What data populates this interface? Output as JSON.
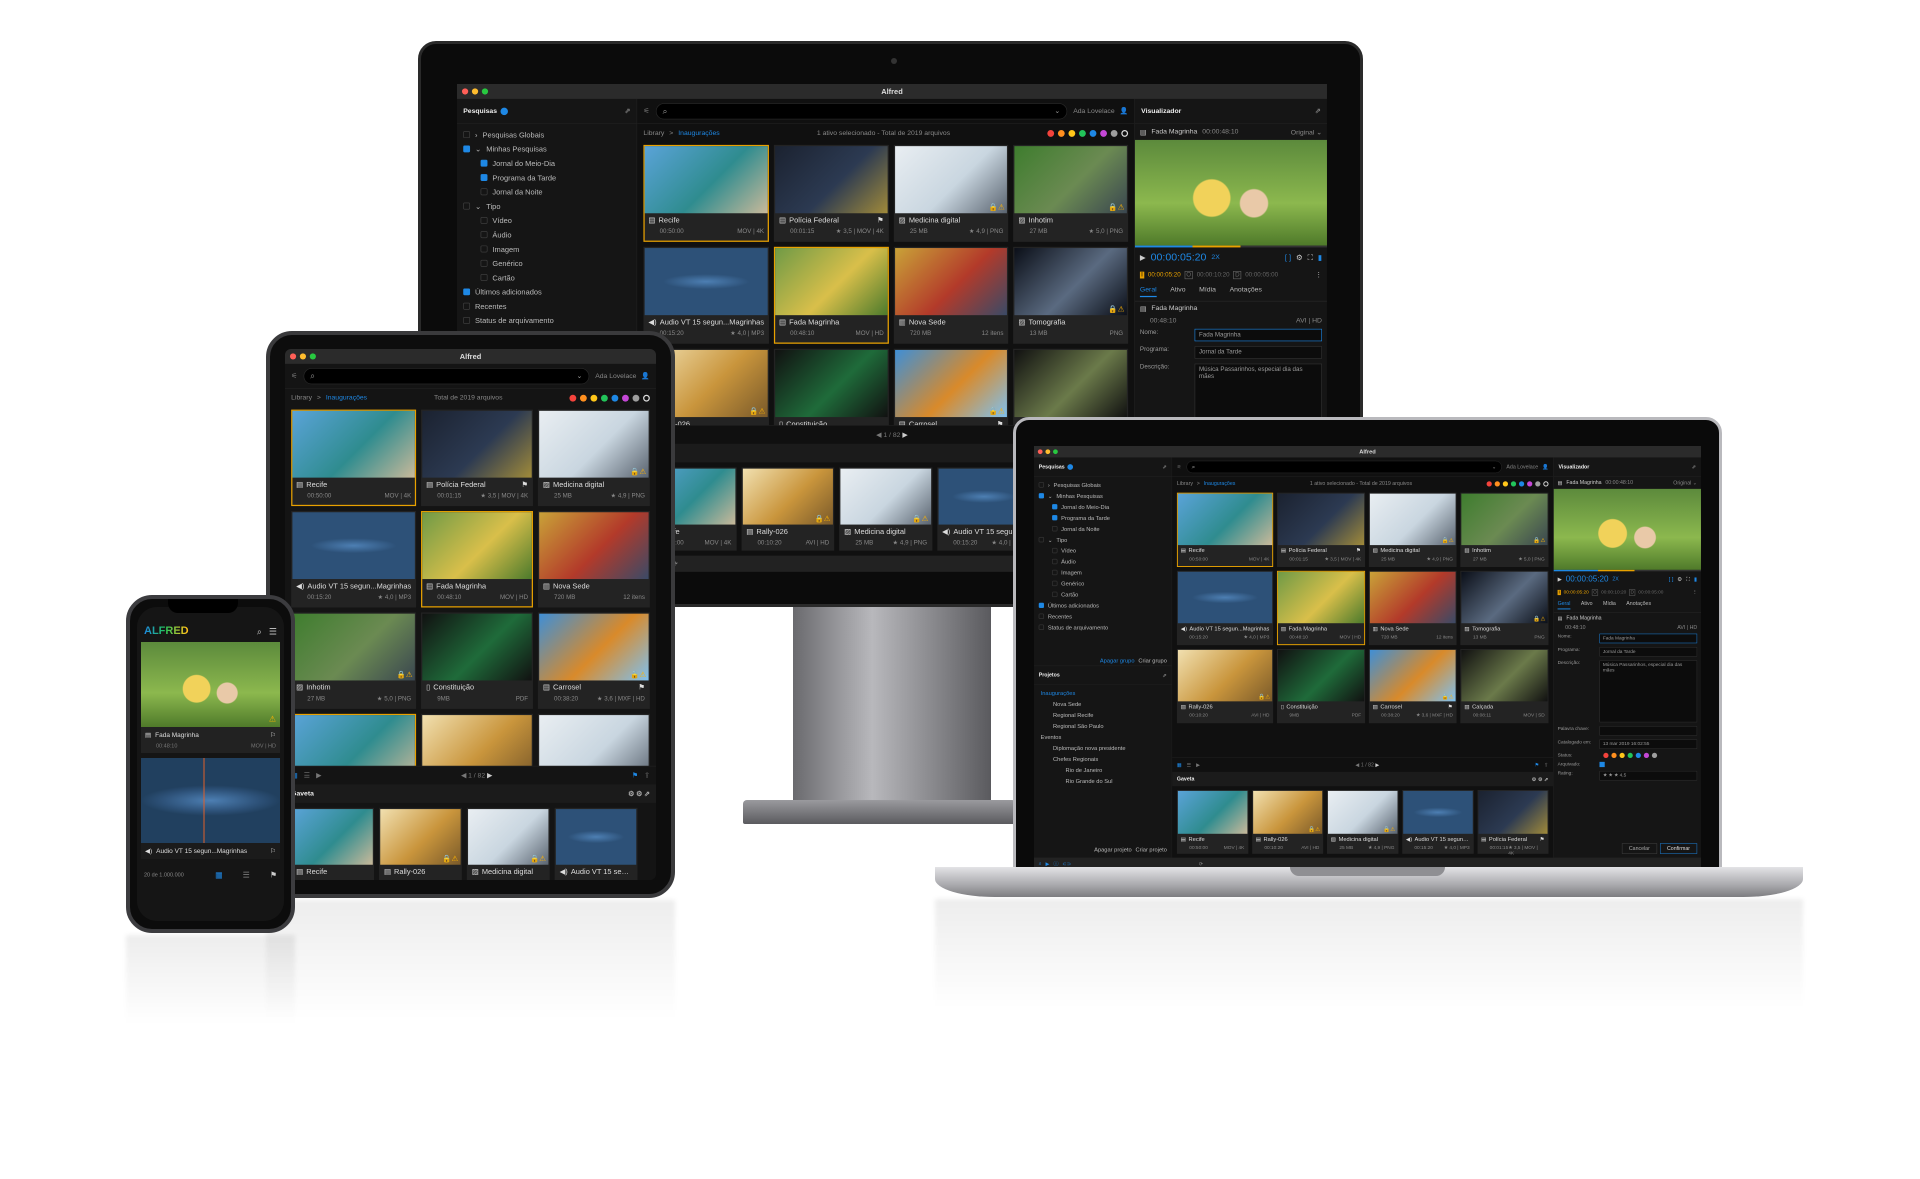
{
  "app": {
    "title": "Alfred",
    "user": "Ada Lovelace",
    "search_placeholder": "",
    "searches_title": "Pesquisas",
    "tree": [
      {
        "label": "Pesquisas Globais",
        "level": 0,
        "arrow": "›",
        "checked": false
      },
      {
        "label": "Minhas Pesquisas",
        "level": 0,
        "arrow": "⌄",
        "checked": true
      },
      {
        "label": "Jornal do Meio-Dia",
        "level": 1,
        "checked": true
      },
      {
        "label": "Programa da Tarde",
        "level": 1,
        "checked": true
      },
      {
        "label": "Jornal da Noite",
        "level": 1,
        "checked": false
      },
      {
        "label": "Tipo",
        "level": 0,
        "arrow": "⌄",
        "checked": false
      },
      {
        "label": "Vídeo",
        "level": 1,
        "checked": false
      },
      {
        "label": "Áudio",
        "level": 1,
        "checked": false
      },
      {
        "label": "Imagem",
        "level": 1,
        "checked": false
      },
      {
        "label": "Genérico",
        "level": 1,
        "checked": false
      },
      {
        "label": "Cartão",
        "level": 1,
        "checked": false
      },
      {
        "label": "Últimos adicionados",
        "level": 0,
        "checked": true
      },
      {
        "label": "Recentes",
        "level": 0,
        "checked": false
      },
      {
        "label": "Status de arquivamento",
        "level": 0,
        "checked": false
      }
    ],
    "group_actions": {
      "delete": "Apagar grupo",
      "create": "Criar grupo"
    },
    "projects_title": "Projetos",
    "projects": [
      {
        "label": "Inaugurações",
        "level": 0,
        "active": true
      },
      {
        "label": "Nova Sede",
        "level": 1
      },
      {
        "label": "Regional Recife",
        "level": 1
      },
      {
        "label": "Regional São Paulo",
        "level": 1
      },
      {
        "label": "Eventos",
        "level": 0
      },
      {
        "label": "Diplomação nova presidente",
        "level": 1
      },
      {
        "label": "Chefes Regionais",
        "level": 1
      },
      {
        "label": "Rio de Janeiro",
        "level": 2
      },
      {
        "label": "Rio Grande do Sul",
        "level": 2
      }
    ],
    "project_actions": {
      "delete": "Apagar projeto",
      "create": "Criar projeto"
    },
    "breadcrumb": {
      "root": "Library",
      "current": "Inaugurações"
    },
    "selection_text": "1 ativo selecionado - Total de 2019 arquivos",
    "total_text": "Total de 2019 arquivos",
    "status_colors": [
      "#f4433c",
      "#ff8f1f",
      "#ffc61a",
      "#22c45a",
      "#1e88e5",
      "#c447d6",
      "#9e9e9e"
    ],
    "page": "1 / 82",
    "drawer_title": "Gaveta",
    "assets": [
      {
        "title": "Recife",
        "sub": "00:50:00",
        "info": "MOV | 4K",
        "icon": "film",
        "colors": [
          "#5aa3d8",
          "#2f8c8f",
          "#c9b99a"
        ],
        "selected": true
      },
      {
        "title": "Polícia Federal",
        "sub": "00:01:15",
        "info": "★ 3,5 | MOV | 4K",
        "icon": "film",
        "colors": [
          "#1b2230",
          "#2c3a52",
          "#a08a3a"
        ],
        "bookmark": true
      },
      {
        "title": "Medicina digital",
        "sub": "25 MB",
        "info": "★ 4,9 | PNG",
        "icon": "image",
        "colors": [
          "#e9eef2",
          "#c9d6e0",
          "#5a6470"
        ],
        "warn": true
      },
      {
        "title": "Inhotim",
        "sub": "27 MB",
        "info": "★ 5,0 | PNG",
        "icon": "image",
        "colors": [
          "#3e7d2e",
          "#6b8a52",
          "#3a4650"
        ],
        "warn": true
      },
      {
        "title": "Audio VT 15 segun...Magrinhas",
        "sub": "00:15:20",
        "info": "★ 4,0 | MP3",
        "icon": "audio",
        "colors": [
          "#2d5178",
          "#3d6a99",
          "#2d5178"
        ]
      },
      {
        "title": "Fada Magrinha",
        "sub": "00:48:10",
        "info": "MOV | HD",
        "icon": "film",
        "colors": [
          "#6f9a46",
          "#d9bf4a",
          "#4c7a2c"
        ],
        "selected": true
      },
      {
        "title": "Nova Sede",
        "sub": "720 MB",
        "info": "12 itens",
        "icon": "folder",
        "colors": [
          "#c9a238",
          "#b33a2a",
          "#3a4a66"
        ]
      },
      {
        "title": "Tomografia",
        "sub": "13 MB",
        "info": "PNG",
        "icon": "image",
        "colors": [
          "#0b0f18",
          "#5a6a80",
          "#0b0f18"
        ],
        "warn": true
      },
      {
        "title": "Rally-026",
        "sub": "00:10:20",
        "info": "AVI | HD",
        "icon": "film",
        "colors": [
          "#f1e0b0",
          "#c9953c",
          "#7a5a2a"
        ],
        "warn": true
      },
      {
        "title": "Constituição",
        "sub": "9MB",
        "info": "PDF",
        "icon": "document",
        "colors": [
          "#111111",
          "#1f6b3a",
          "#111111"
        ]
      },
      {
        "title": "Carrosel",
        "sub": "00:38:20",
        "info": "★ 3,6 | MXF | HD",
        "icon": "film",
        "colors": [
          "#3f8fd6",
          "#d98a2a",
          "#7fc0ee"
        ],
        "bookmark": true,
        "warn": true
      },
      {
        "title": "Calçada",
        "sub": "00:08:11",
        "info": "MOV | SD",
        "icon": "film",
        "colors": [
          "#111111",
          "#6b7a4a",
          "#111111"
        ]
      }
    ],
    "drawer": [
      0,
      8,
      2,
      4,
      1
    ],
    "viewer": {
      "title": "Visualizador",
      "clip": "Fada Magrinha",
      "clip_tc": "00:00:48:10",
      "quality": "Original",
      "timecode": "00:00:05:20",
      "speed": "2X",
      "mark_in": "00:00:05:20",
      "mark_out": "00:00:10:20",
      "duration": "00:00:05:00",
      "tabs": [
        "Geral",
        "Ativo",
        "Mídia",
        "Anotações"
      ],
      "asset_name": "Fada Magrinha",
      "asset_duration": "00:48:10",
      "asset_format": "AVI | HD",
      "fields": [
        {
          "label": "Nome:",
          "value": "Fada Magrinha"
        },
        {
          "label": "Programa:",
          "value": "Jornal da Tarde"
        },
        {
          "label": "Descrição:",
          "value": "Música Passarinhos, especial dia das mães"
        },
        {
          "label": "Palavra chave:",
          "value": ""
        },
        {
          "label": "Catalogado em:",
          "value": "13 mar 2019 16:02:55"
        },
        {
          "label": "Status:",
          "value": ""
        },
        {
          "label": "Arquivado:",
          "value": ""
        },
        {
          "label": "Rating:",
          "value": "★ ★ ★   4,5"
        }
      ],
      "cancel": "Cancelar",
      "confirm": "Confirmar"
    }
  },
  "phone": {
    "logo": "ALFRED",
    "items": [
      {
        "title": "Fada Magrinha",
        "sub": "00:48:10",
        "info": "MOV | HD"
      },
      {
        "title": "Audio VT 15 segun...Magrinhas"
      }
    ],
    "count": "20 de 1.000.000"
  }
}
